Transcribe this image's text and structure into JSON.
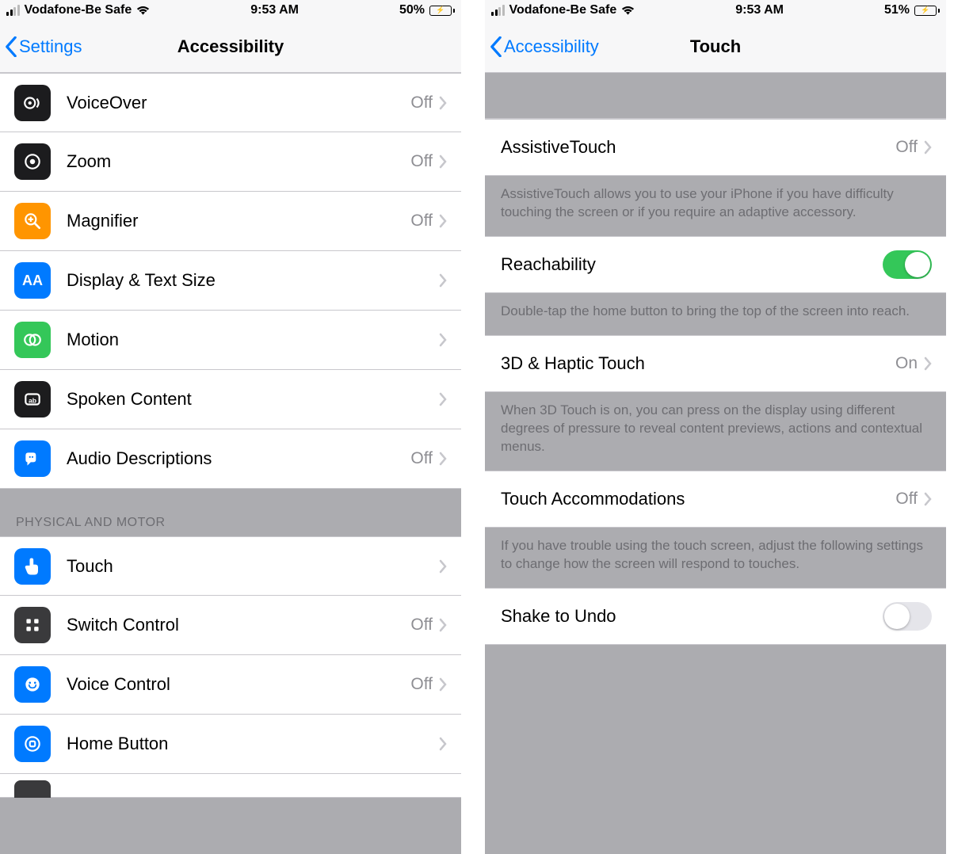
{
  "left": {
    "status": {
      "carrier": "Vodafone-Be Safe",
      "time": "9:53 AM",
      "battery_pct": "50%"
    },
    "nav": {
      "back": "Settings",
      "title": "Accessibility"
    },
    "rows": [
      {
        "label": "VoiceOver",
        "value": "Off"
      },
      {
        "label": "Zoom",
        "value": "Off"
      },
      {
        "label": "Magnifier",
        "value": "Off"
      },
      {
        "label": "Display & Text Size",
        "value": ""
      },
      {
        "label": "Motion",
        "value": ""
      },
      {
        "label": "Spoken Content",
        "value": ""
      },
      {
        "label": "Audio Descriptions",
        "value": "Off"
      }
    ],
    "section_header": "Physical and Motor",
    "rows2": [
      {
        "label": "Touch",
        "value": ""
      },
      {
        "label": "Switch Control",
        "value": "Off"
      },
      {
        "label": "Voice Control",
        "value": "Off"
      },
      {
        "label": "Home Button",
        "value": ""
      }
    ]
  },
  "right": {
    "status": {
      "carrier": "Vodafone-Be Safe",
      "time": "9:53 AM",
      "battery_pct": "51%"
    },
    "nav": {
      "back": "Accessibility",
      "title": "Touch"
    },
    "assistive": {
      "label": "AssistiveTouch",
      "value": "Off",
      "desc": "AssistiveTouch allows you to use your iPhone if you have difficulty touching the screen or if you require an adaptive accessory."
    },
    "reachability": {
      "label": "Reachability",
      "on": true,
      "desc": "Double-tap the home button to bring the top of the screen into reach."
    },
    "haptic": {
      "label": "3D & Haptic Touch",
      "value": "On",
      "desc": "When 3D Touch is on, you can press on the display using different degrees of pressure to reveal content previews, actions and contextual menus."
    },
    "accom": {
      "label": "Touch Accommodations",
      "value": "Off",
      "desc": "If you have trouble using the touch screen, adjust the following settings to change how the screen will respond to touches."
    },
    "shake": {
      "label": "Shake to Undo",
      "on": false
    }
  }
}
